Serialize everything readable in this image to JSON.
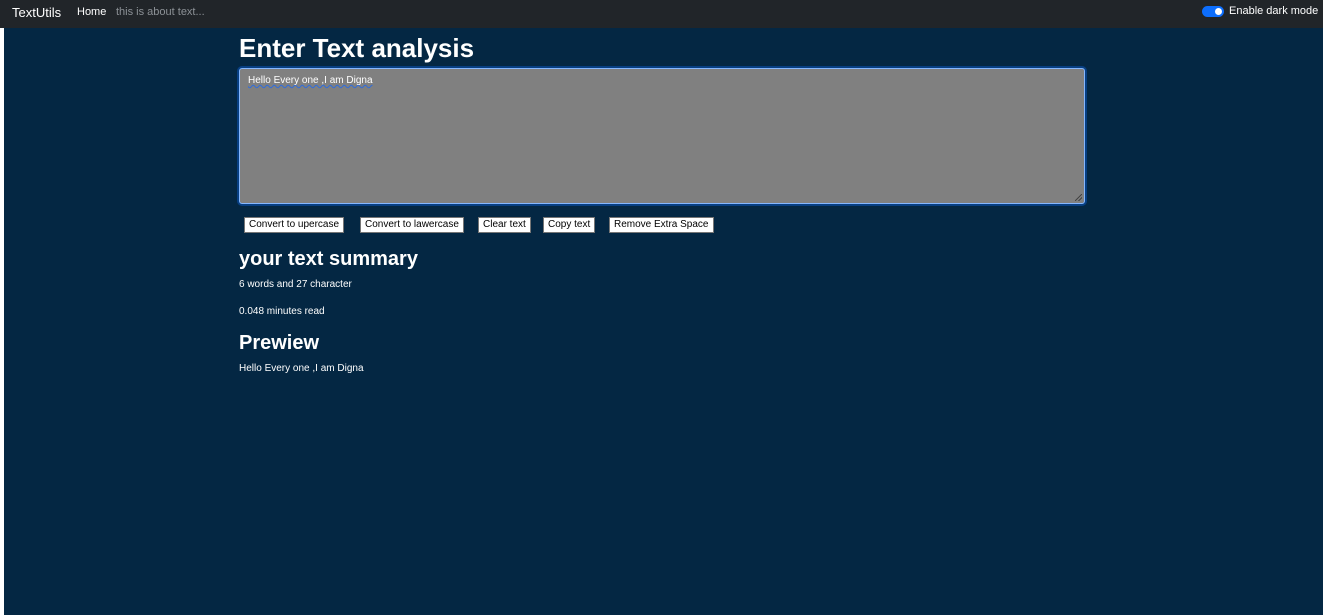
{
  "navbar": {
    "brand": "TextUtils",
    "home": "Home",
    "about": "this is about text...",
    "dark_mode_label": "Enable dark mode",
    "dark_mode_on": true
  },
  "main": {
    "heading": "Enter Text analysis",
    "textarea_value": "Hello Every one ,I am Digna",
    "buttons": {
      "upper": "Convert to upercase",
      "lower": "Convert to lawercase",
      "clear": "Clear text",
      "copy": "Copy text",
      "remove_space": "Remove Extra Space"
    },
    "summary_heading": "your text summary",
    "word_count_text": "6 words and 27 character",
    "read_time_text": "0.048 minutes read",
    "preview_heading": "Prewiew",
    "preview_text": "Hello Every one ,I am Digna"
  },
  "colors": {
    "navbar_bg": "#212529",
    "main_bg": "#042743",
    "textarea_bg": "#808080",
    "toggle_accent": "#0d6efd"
  }
}
